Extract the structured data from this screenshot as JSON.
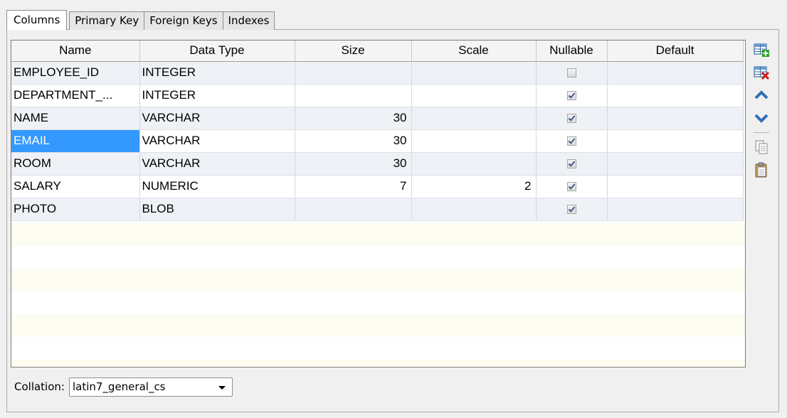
{
  "tabs": [
    {
      "label": "Columns",
      "active": true
    },
    {
      "label": "Primary Key",
      "active": false
    },
    {
      "label": "Foreign Keys",
      "active": false
    },
    {
      "label": "Indexes",
      "active": false
    }
  ],
  "grid": {
    "headers": [
      "Name",
      "Data Type",
      "Size",
      "Scale",
      "Nullable",
      "Default"
    ],
    "rows": [
      {
        "name": "EMPLOYEE_ID",
        "type": "INTEGER",
        "size": "",
        "scale": "",
        "nullable": false,
        "default": ""
      },
      {
        "name": "DEPARTMENT_...",
        "type": "INTEGER",
        "size": "",
        "scale": "",
        "nullable": true,
        "default": ""
      },
      {
        "name": "NAME",
        "type": "VARCHAR",
        "size": "30",
        "scale": "",
        "nullable": true,
        "default": ""
      },
      {
        "name": "EMAIL",
        "type": "VARCHAR",
        "size": "30",
        "scale": "",
        "nullable": true,
        "default": ""
      },
      {
        "name": "ROOM",
        "type": "VARCHAR",
        "size": "30",
        "scale": "",
        "nullable": true,
        "default": ""
      },
      {
        "name": "SALARY",
        "type": "NUMERIC",
        "size": "7",
        "scale": "2",
        "nullable": true,
        "default": ""
      },
      {
        "name": "PHOTO",
        "type": "BLOB",
        "size": "",
        "scale": "",
        "nullable": true,
        "default": ""
      }
    ],
    "selected_row": 3,
    "selected_color": "#3399ff"
  },
  "toolbar": {
    "icons": [
      "add-column-icon",
      "delete-column-icon",
      "move-up-icon",
      "move-down-icon",
      "copy-icon",
      "paste-icon"
    ]
  },
  "collation": {
    "label": "Collation:",
    "value": "latin7_general_cs"
  }
}
